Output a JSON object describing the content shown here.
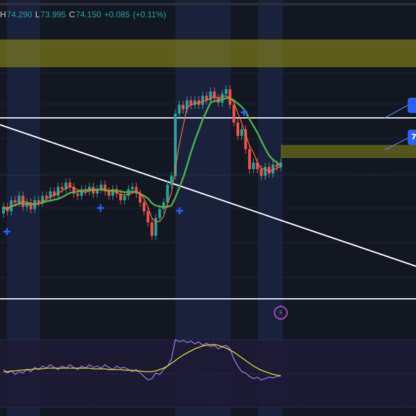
{
  "ohlc": {
    "high_label": "H",
    "high": "74.290",
    "low_label": "L",
    "low": "73.995",
    "close_label": "C",
    "close": "74.150",
    "change": "+0.085",
    "change_pct": "(+0.11%)"
  },
  "colors": {
    "background": "#131722",
    "session_band": "#1b2340",
    "up_candle": "#26a69a",
    "down_candle": "#ef5350",
    "ma_slow": "#4caf50",
    "ma_fast": "#ff7043",
    "zone": "#8d8a17",
    "rsi_line": "#9575cd",
    "rsi_ma": "#e6e23a",
    "signal": "#2962ff"
  },
  "badges": [
    {
      "text": ""
    },
    {
      "text": "7"
    }
  ],
  "icons": {
    "alert": "bolt-icon"
  },
  "chart_data": {
    "type": "candlestick",
    "candles": [
      {
        "o": 35,
        "c": 38
      },
      {
        "o": 38,
        "c": 36
      },
      {
        "o": 36,
        "c": 41
      },
      {
        "o": 41,
        "c": 40
      },
      {
        "o": 40,
        "c": 43
      },
      {
        "o": 43,
        "c": 38
      },
      {
        "o": 38,
        "c": 40
      },
      {
        "o": 40,
        "c": 37
      },
      {
        "o": 37,
        "c": 41
      },
      {
        "o": 41,
        "c": 40
      },
      {
        "o": 40,
        "c": 43
      },
      {
        "o": 43,
        "c": 42
      },
      {
        "o": 42,
        "c": 45
      },
      {
        "o": 45,
        "c": 43
      },
      {
        "o": 43,
        "c": 47
      },
      {
        "o": 47,
        "c": 46
      },
      {
        "o": 46,
        "c": 49
      },
      {
        "o": 49,
        "c": 47
      },
      {
        "o": 47,
        "c": 44
      },
      {
        "o": 44,
        "c": 43
      },
      {
        "o": 43,
        "c": 46
      },
      {
        "o": 46,
        "c": 45
      },
      {
        "o": 45,
        "c": 47
      },
      {
        "o": 47,
        "c": 44
      },
      {
        "o": 44,
        "c": 46
      },
      {
        "o": 46,
        "c": 48
      },
      {
        "o": 48,
        "c": 45
      },
      {
        "o": 45,
        "c": 43
      },
      {
        "o": 43,
        "c": 46
      },
      {
        "o": 46,
        "c": 44
      },
      {
        "o": 44,
        "c": 41
      },
      {
        "o": 41,
        "c": 43
      },
      {
        "o": 43,
        "c": 46
      },
      {
        "o": 46,
        "c": 47
      },
      {
        "o": 47,
        "c": 44
      },
      {
        "o": 44,
        "c": 40
      },
      {
        "o": 40,
        "c": 36
      },
      {
        "o": 36,
        "c": 31
      },
      {
        "o": 31,
        "c": 25
      },
      {
        "o": 25,
        "c": 33
      },
      {
        "o": 33,
        "c": 37
      },
      {
        "o": 37,
        "c": 40
      },
      {
        "o": 40,
        "c": 48
      },
      {
        "o": 48,
        "c": 52
      },
      {
        "o": 52,
        "c": 80
      },
      {
        "o": 80,
        "c": 84
      },
      {
        "o": 84,
        "c": 82
      },
      {
        "o": 82,
        "c": 86
      },
      {
        "o": 86,
        "c": 84
      },
      {
        "o": 84,
        "c": 86
      },
      {
        "o": 86,
        "c": 84
      },
      {
        "o": 84,
        "c": 88
      },
      {
        "o": 88,
        "c": 86
      },
      {
        "o": 86,
        "c": 90
      },
      {
        "o": 90,
        "c": 87
      },
      {
        "o": 87,
        "c": 85
      },
      {
        "o": 85,
        "c": 89
      },
      {
        "o": 89,
        "c": 91
      },
      {
        "o": 91,
        "c": 84
      },
      {
        "o": 84,
        "c": 76
      },
      {
        "o": 76,
        "c": 70
      },
      {
        "o": 70,
        "c": 73
      },
      {
        "o": 73,
        "c": 64
      },
      {
        "o": 64,
        "c": 55
      },
      {
        "o": 55,
        "c": 58
      },
      {
        "o": 58,
        "c": 55
      },
      {
        "o": 55,
        "c": 52
      },
      {
        "o": 52,
        "c": 56
      },
      {
        "o": 56,
        "c": 53
      },
      {
        "o": 53,
        "c": 57
      },
      {
        "o": 57,
        "c": 56
      },
      {
        "o": 56,
        "c": 58
      }
    ],
    "rsi": [
      55,
      50,
      53,
      48,
      52,
      50,
      55,
      52,
      58,
      55,
      60,
      57,
      62,
      58,
      55,
      60,
      57,
      62,
      58,
      55,
      60,
      57,
      62,
      58,
      60,
      57,
      62,
      58,
      55,
      60,
      57,
      58,
      55,
      52,
      55,
      50,
      45,
      40,
      42,
      50,
      48,
      55,
      60,
      70,
      98,
      95,
      97,
      94,
      96,
      92,
      95,
      90,
      93,
      88,
      90,
      85,
      88,
      90,
      85,
      70,
      60,
      52,
      50,
      45,
      42,
      44,
      40,
      42,
      44,
      43,
      45,
      46
    ],
    "rsi_ma": [
      52,
      52,
      53,
      53,
      54,
      54,
      55,
      55,
      56,
      56,
      56,
      57,
      57,
      57,
      57,
      57,
      57,
      57,
      57,
      57,
      57,
      57,
      57,
      56,
      56,
      56,
      56,
      55,
      55,
      55,
      55,
      54,
      54,
      54,
      53,
      53,
      52,
      52,
      52,
      53,
      55,
      57,
      60,
      64,
      68,
      72,
      76,
      79,
      82,
      85,
      87,
      89,
      90,
      91,
      91,
      90,
      88,
      86,
      83,
      80,
      76,
      72,
      68,
      64,
      60,
      57,
      54,
      52,
      50,
      48,
      47,
      46
    ]
  }
}
